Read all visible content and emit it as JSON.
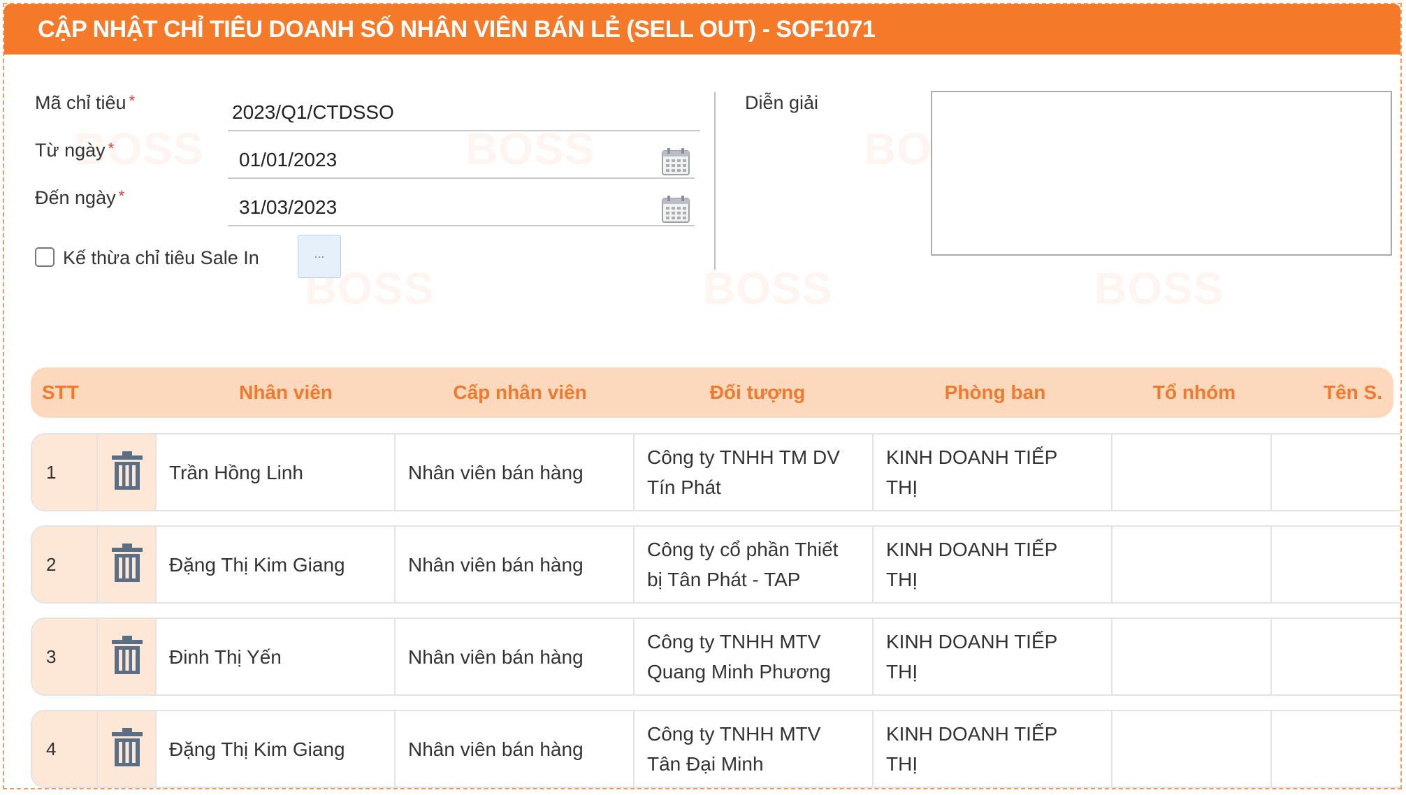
{
  "title": "CẬP NHẬT CHỈ TIÊU DOANH SỐ NHÂN VIÊN BÁN LẺ (SELL OUT) - SOF1071",
  "form": {
    "code_label": "Mã chỉ tiêu",
    "code_value": "2023/Q1/CTDSSO",
    "from_label": "Từ ngày",
    "from_value": "01/01/2023",
    "to_label": "Đến ngày",
    "to_value": "31/03/2023",
    "required_mark": "*",
    "inherit_label": "Kế thừa chỉ tiêu Sale In",
    "inherit_btn": "...",
    "desc_label": "Diễn giải"
  },
  "watermark": "BOSS",
  "table": {
    "headers": [
      "STT",
      "Nhân viên",
      "Cấp nhân viên",
      "Đối tượng",
      "Phòng ban",
      "Tổ nhóm",
      "Tên S."
    ],
    "rows": [
      {
        "stt": "1",
        "employee": "Trần Hồng Linh",
        "level": "Nhân viên bán hàng",
        "object_l1": "Công ty TNHH TM DV",
        "object_l2": "Tín Phát",
        "dept_l1": "KINH DOANH TIẾP",
        "dept_l2": "THỊ"
      },
      {
        "stt": "2",
        "employee": "Đặng Thị Kim Giang",
        "level": "Nhân viên bán hàng",
        "object_l1": "Công ty cổ phần Thiết",
        "object_l2": "bị Tân Phát - TAP",
        "dept_l1": "KINH DOANH TIẾP",
        "dept_l2": "THỊ"
      },
      {
        "stt": "3",
        "employee": "Đinh Thị Yến",
        "level": "Nhân viên bán hàng",
        "object_l1": "Công ty TNHH MTV",
        "object_l2": "Quang Minh Phương",
        "dept_l1": "KINH DOANH TIẾP",
        "dept_l2": "THỊ"
      },
      {
        "stt": "4",
        "employee": "Đặng Thị Kim Giang",
        "level": "Nhân viên bán hàng",
        "object_l1": "Công ty TNHH MTV",
        "object_l2": "Tân Đại Minh",
        "dept_l1": "KINH DOANH TIẾP",
        "dept_l2": "THỊ"
      }
    ]
  },
  "colors": {
    "accent": "#f47a2a",
    "header_bg": "#fcd9bd",
    "row_lead_bg": "#fde8d7"
  },
  "icons": {
    "delete": "trash-icon",
    "date": "calendar-icon"
  }
}
